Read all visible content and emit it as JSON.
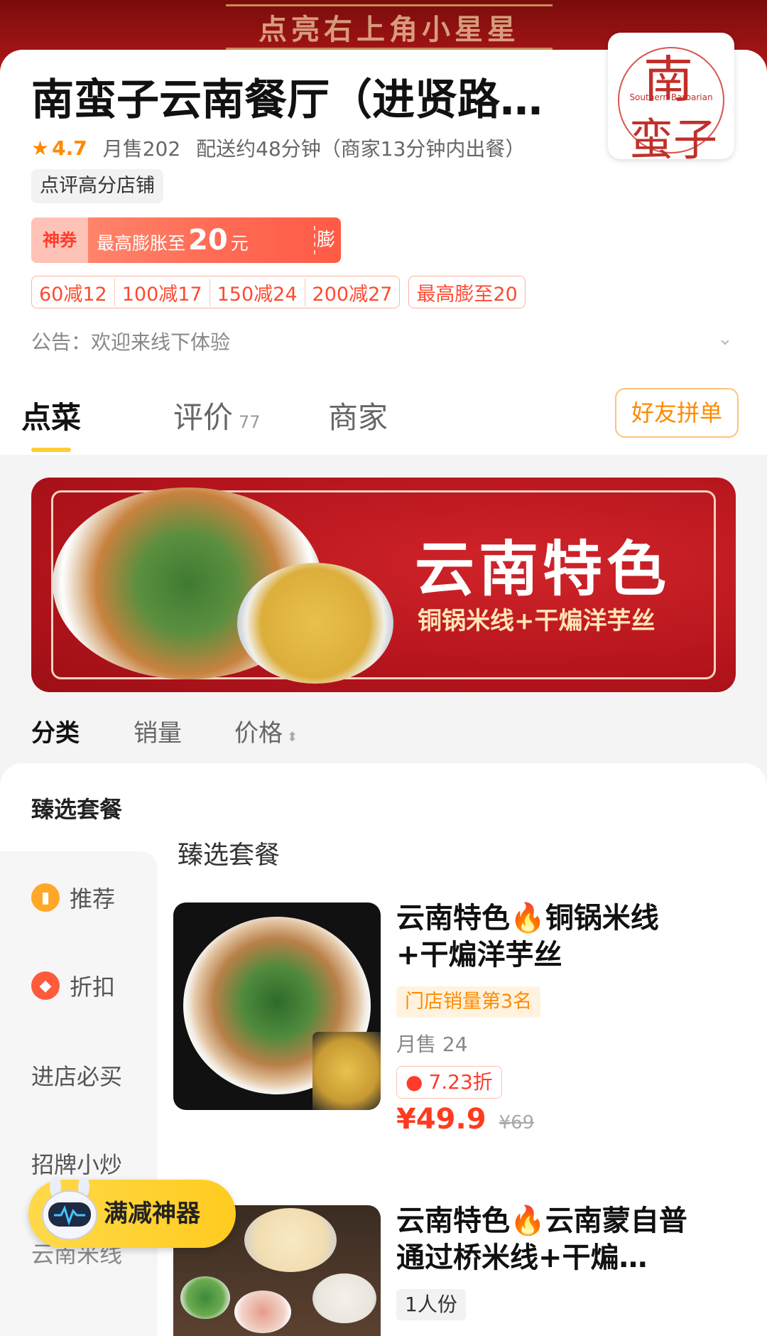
{
  "top_banner": {
    "text": "点亮右上角小星星"
  },
  "store": {
    "name": "南蛮子云南餐厅（进贤路…",
    "logo_top": "南",
    "logo_latin": "Southern Barbarian",
    "logo_bottom": "蛮子",
    "rating": "4.7",
    "monthly_sales": "月售202",
    "delivery": "配送约48分钟（商家13分钟内出餐）",
    "badge": "点评高分店铺"
  },
  "coupon": {
    "tag": "神券",
    "prefix": "最高膨胀至",
    "amount": "20",
    "unit": "元",
    "action": "膨胀"
  },
  "discounts": {
    "tiers": [
      "60减12",
      "100减17",
      "150减24",
      "200减27"
    ],
    "extra": "最高膨至20"
  },
  "notice": "公告：欢迎来线下体验",
  "tabs": {
    "order": "点菜",
    "reviews": "评价",
    "reviews_count": "77",
    "merchant": "商家",
    "group_order": "好友拼单"
  },
  "banner": {
    "title": "云南特色",
    "subtitle": "铜锅米线+干煸洋芋丝"
  },
  "sort": {
    "category": "分类",
    "sales": "销量",
    "price": "价格"
  },
  "sidebar": {
    "title": "臻选套餐",
    "items": [
      {
        "label": "推荐",
        "icon": "bookmark-icon"
      },
      {
        "label": "折扣",
        "icon": "discount-tag-icon"
      },
      {
        "label": "进店必买"
      },
      {
        "label": "招牌小炒"
      },
      {
        "label": "云南米线"
      }
    ]
  },
  "menu": {
    "section_title": "臻选套餐",
    "dishes": [
      {
        "name_line1_a": "云南特色",
        "name_line1_b": "铜锅米线",
        "name_line2": "+干煸洋芋丝",
        "rank": "门店销量第3名",
        "monthly": "月售 24",
        "discount": "7.23折",
        "price": "¥49.9",
        "original_price": "¥69"
      },
      {
        "name_line1_a": "云南特色",
        "name_line1_b": "云南蒙自普",
        "name_line2": "通过桥米线+干煸…",
        "serving": "1人份"
      }
    ]
  },
  "floating": {
    "label": "满减神器"
  },
  "colors": {
    "accent": "#ffcc33",
    "price": "#ff3b1f",
    "brand_red": "#b5141c"
  }
}
